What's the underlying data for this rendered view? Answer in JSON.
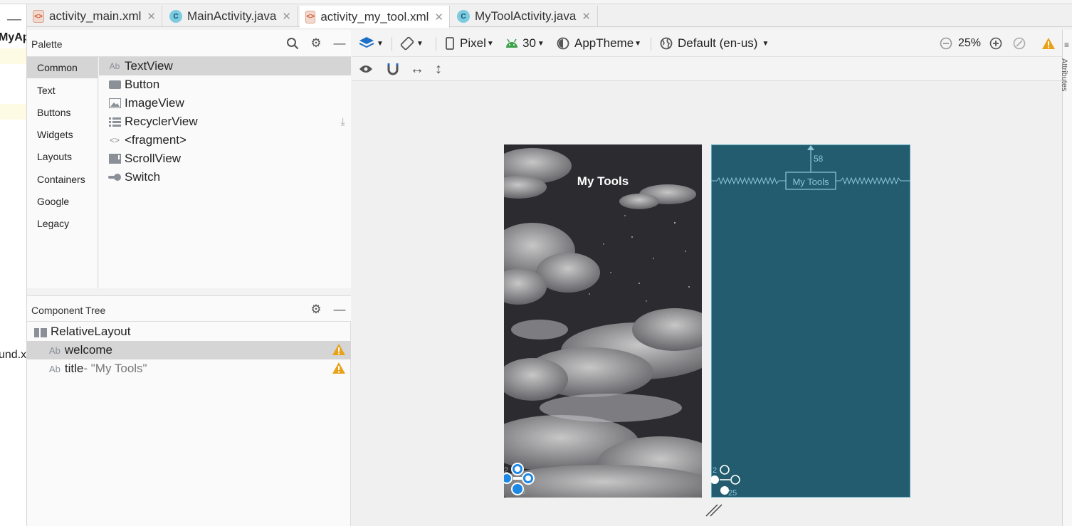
{
  "project_strip": {
    "app_label": "MyAp",
    "file_label": "und.xr"
  },
  "tabs": [
    {
      "label": "activity_main.xml",
      "type": "xml",
      "active": false
    },
    {
      "label": "MainActivity.java",
      "type": "java",
      "active": false
    },
    {
      "label": "activity_my_tool.xml",
      "type": "xml",
      "active": true
    },
    {
      "label": "MyToolActivity.java",
      "type": "java",
      "active": false
    }
  ],
  "palette": {
    "title": "Palette",
    "categories": [
      "Common",
      "Text",
      "Buttons",
      "Widgets",
      "Layouts",
      "Containers",
      "Google",
      "Legacy"
    ],
    "selected_category": "Common",
    "widgets": [
      {
        "label": "TextView",
        "icon": "textview-icon"
      },
      {
        "label": "Button",
        "icon": "button-icon"
      },
      {
        "label": "ImageView",
        "icon": "image-icon"
      },
      {
        "label": "RecyclerView",
        "icon": "list-icon"
      },
      {
        "label": "<fragment>",
        "icon": "code-brackets-icon"
      },
      {
        "label": "ScrollView",
        "icon": "scrollview-icon"
      },
      {
        "label": "Switch",
        "icon": "switch-icon"
      }
    ]
  },
  "component_tree": {
    "title": "Component Tree",
    "root": "RelativeLayout",
    "items": [
      {
        "prefix": "Ab",
        "label": "welcome",
        "detail": "",
        "warning": true
      },
      {
        "prefix": "Ab",
        "label": "title",
        "detail": "- \"My Tools\"",
        "warning": true
      }
    ]
  },
  "toolbar": {
    "device": "Pixel",
    "api": "30",
    "theme": "AppTheme",
    "locale": "Default (en-us)",
    "zoom": "25%"
  },
  "preview": {
    "title_text": "My Tools",
    "margin_value": "58",
    "blueprint_label": "My Tools",
    "corner_a": "2",
    "corner_b": "25"
  },
  "right_panel": {
    "label": "Attributes"
  },
  "colors": {
    "blueprint_bg": "#225c6e",
    "warning": "#e8a21a",
    "selection": "#d5d5d5",
    "constraint_blue": "#1e88e5"
  }
}
